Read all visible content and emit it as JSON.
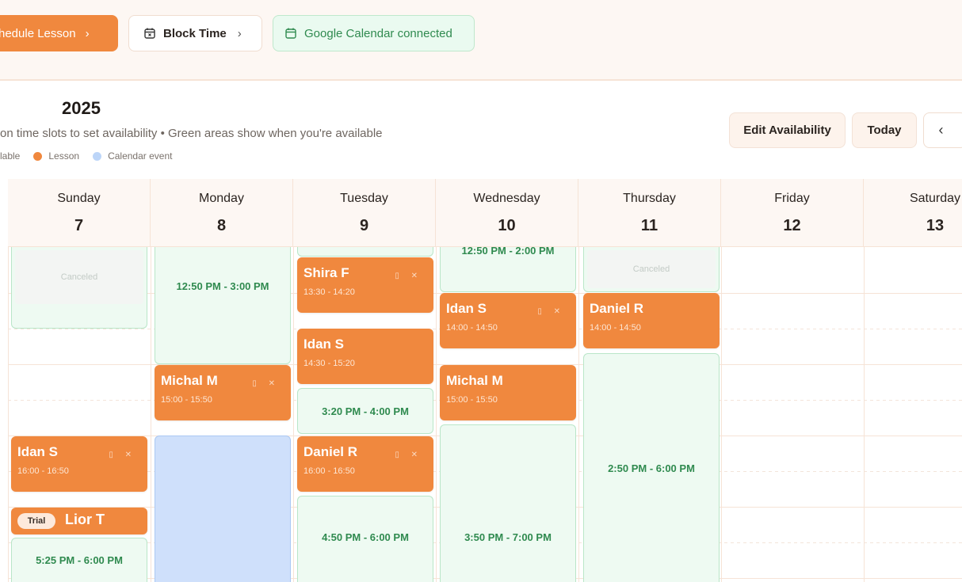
{
  "toolbar": {
    "schedule_label": "hedule Lesson",
    "block_label": "Block Time",
    "gcal_label": "Google Calendar connected"
  },
  "header": {
    "year": "2025",
    "hint": "on time slots to set availability • Green areas show when you're available",
    "legend": {
      "available": "lable",
      "lesson": "Lesson",
      "calendar_event": "Calendar event"
    },
    "edit_label": "Edit Availability",
    "today_label": "Today",
    "prev_label": "‹"
  },
  "days": [
    {
      "name": "Sunday",
      "num": "7"
    },
    {
      "name": "Monday",
      "num": "8"
    },
    {
      "name": "Tuesday",
      "num": "9"
    },
    {
      "name": "Wednesday",
      "num": "10"
    },
    {
      "name": "Thursday",
      "num": "11"
    },
    {
      "name": "Friday",
      "num": "12"
    },
    {
      "name": "Saturday",
      "num": "13"
    }
  ],
  "availability": {
    "sun_canceled": "Canceled",
    "sun_late": "5:25 PM - 6:00 PM",
    "mon_1": "12:50 PM - 3:00 PM",
    "tue_1": "3:20 PM - 4:00 PM",
    "tue_2": "4:50 PM - 6:00 PM",
    "wed_1": "12:50 PM - 2:00 PM",
    "wed_2": "3:50 PM - 7:00 PM",
    "thu_canceled": "Canceled",
    "thu_1": "2:50 PM - 6:00 PM"
  },
  "lessons": {
    "sun_idan": {
      "name": "Idan S",
      "time": "16:00 - 16:50"
    },
    "sun_lior": {
      "badge": "Trial",
      "name": "Lior T"
    },
    "mon_michal": {
      "name": "Michal M",
      "time": "15:00 - 15:50"
    },
    "tue_shira": {
      "name": "Shira F",
      "time": "13:30 - 14:20"
    },
    "tue_idan": {
      "name": "Idan S",
      "time": "14:30 - 15:20"
    },
    "tue_daniel": {
      "name": "Daniel R",
      "time": "16:00 - 16:50"
    },
    "wed_idan": {
      "name": "Idan S",
      "time": "14:00 - 14:50"
    },
    "wed_michal": {
      "name": "Michal M",
      "time": "15:00 - 15:50"
    },
    "thu_daniel": {
      "name": "Daniel R",
      "time": "14:00 - 14:50"
    }
  },
  "colors": {
    "lesson": "#f0883e",
    "available": "#eefaf2",
    "calendar_event": "#cfe0fb",
    "accent_text": "#2f8a4f"
  }
}
